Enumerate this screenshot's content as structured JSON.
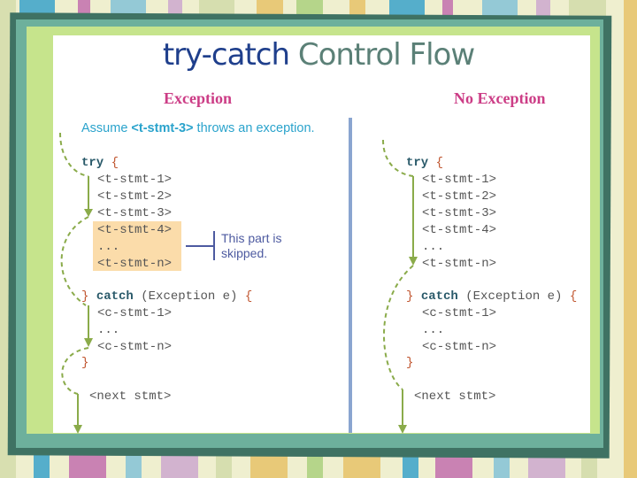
{
  "title": {
    "part1": "try-catch",
    "part2": "Control Flow"
  },
  "columns": {
    "exception": {
      "heading": "Exception",
      "note_prefix": "Assume ",
      "note_bold": "<t-stmt-3>",
      "note_suffix": " throws an exception.",
      "try_kw": "try",
      "open_brace": "{",
      "try_lines": [
        "<t-stmt-1>",
        "<t-stmt-2>",
        "<t-stmt-3>",
        "<t-stmt-4>",
        "...",
        "<t-stmt-n>"
      ],
      "skipped_label_line1": "This part is",
      "skipped_label_line2": "skipped.",
      "close_brace": "}",
      "catch_kw": "catch",
      "catch_param": "(Exception e)",
      "catch_open": "{",
      "catch_lines": [
        "<c-stmt-1>",
        "...",
        "<c-stmt-n>"
      ],
      "catch_close": "}",
      "next": "<next stmt>"
    },
    "no_exception": {
      "heading": "No Exception",
      "try_kw": "try",
      "open_brace": "{",
      "try_lines": [
        "<t-stmt-1>",
        "<t-stmt-2>",
        "<t-stmt-3>",
        "<t-stmt-4>",
        "...",
        "<t-stmt-n>"
      ],
      "close_brace": "}",
      "catch_kw": "catch",
      "catch_param": "(Exception e)",
      "catch_open": "{",
      "catch_lines": [
        "<c-stmt-1>",
        "...",
        "<c-stmt-n>"
      ],
      "catch_close": "}",
      "next": "<next stmt>"
    }
  },
  "colors": {
    "heading": "#cc3d86",
    "note": "#2aa3cc",
    "flow_arrow": "#8aab4a",
    "skip_highlight": "#fbdcaa",
    "divider": "#8aa5d0"
  }
}
